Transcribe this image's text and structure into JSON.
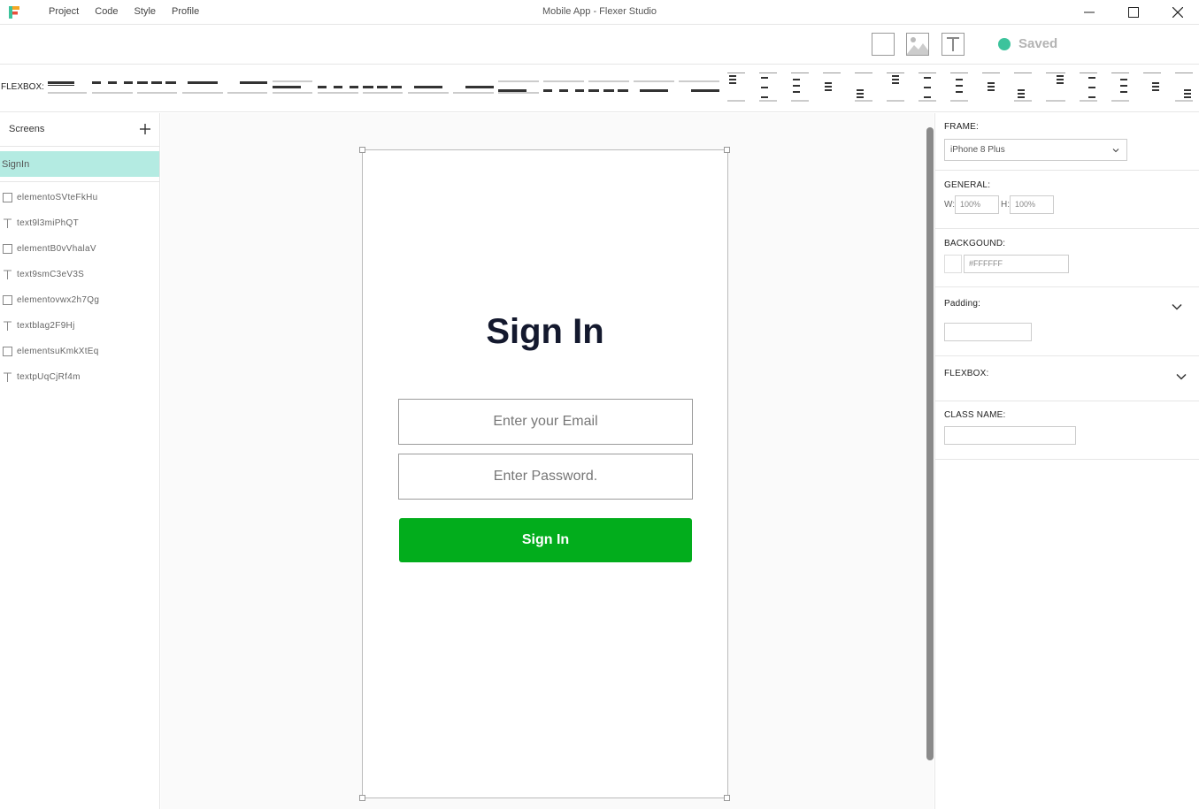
{
  "window": {
    "title": "Mobile App - Flexer Studio",
    "menu": [
      "Project",
      "Code",
      "Style",
      "Profile"
    ]
  },
  "toolbar": {
    "tools": [
      "rectangle-icon",
      "image-icon",
      "text-icon"
    ],
    "saved_label": "Saved",
    "saved_color": "#3cc39c"
  },
  "flexbox_bar": {
    "label": "FLEXBOX:"
  },
  "sidebar": {
    "screens_title": "Screens",
    "active_screen": "SignIn",
    "active_color": "#b4ebe2",
    "layers": [
      {
        "type": "element",
        "name": "elementoSVteFkHu"
      },
      {
        "type": "text",
        "name": "text9l3miPhQT"
      },
      {
        "type": "element",
        "name": "elementB0vVhalaV"
      },
      {
        "type": "text",
        "name": "text9smC3eV3S"
      },
      {
        "type": "element",
        "name": "elementovwx2h7Qg"
      },
      {
        "type": "text",
        "name": "textblag2F9Hj"
      },
      {
        "type": "element",
        "name": "elementsuKmkXtEq"
      },
      {
        "type": "text",
        "name": "textpUqCjRf4m"
      }
    ]
  },
  "phone": {
    "title": "Sign In",
    "email_placeholder": "Enter your Email",
    "password_placeholder": "Enter Password.",
    "button_label": "Sign In",
    "button_color": "#02ad1c"
  },
  "props": {
    "frame_label": "FRAME:",
    "frame_value": "iPhone 8 Plus",
    "general_label": "GENERAL:",
    "w_label": "W:",
    "w_value": "100%",
    "h_label": "H:",
    "h_value": "100%",
    "background_label": "BACKGOUND:",
    "background_value": "#FFFFFF",
    "padding_label": "Padding:",
    "flexbox_label": "FLEXBOX:",
    "classname_label": "CLASS NAME:"
  }
}
